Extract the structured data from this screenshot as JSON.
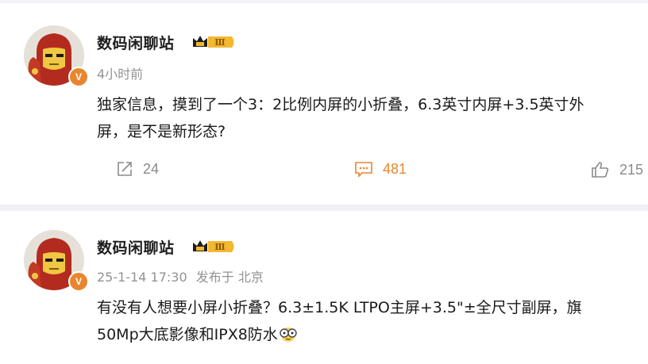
{
  "posts": [
    {
      "author": "数码闲聊站",
      "vip_level": "Ⅲ",
      "verified_badge": "V",
      "time": "4小时前",
      "text_line1": "独家信息，摸到了一个3：2比例内屏的小折叠，6.3英寸内屏+3.5英寸外",
      "text_line2": "屏，是不是新形态?",
      "actions": {
        "repost": "24",
        "comment": "481",
        "like": "215"
      }
    },
    {
      "author": "数码闲聊站",
      "vip_level": "Ⅲ",
      "verified_badge": "V",
      "time": "25-1-14 17:30",
      "source": "发布于 北京",
      "text_line1": "有没有人想要小屏小折叠？6.3±1.5K LTPO主屏+3.5\"±全尺寸副屏，旗",
      "text_line2": "50Mp大底影像和IPX8防水",
      "emoji": "eyeglasses-emoji"
    }
  ],
  "icons": [
    "repost-icon",
    "comment-icon",
    "like-icon",
    "crown-icon"
  ],
  "colors": {
    "accent": "#e8862e",
    "text": "#1a1a1a",
    "muted": "#939393",
    "vip_gold": "#f3b730"
  }
}
